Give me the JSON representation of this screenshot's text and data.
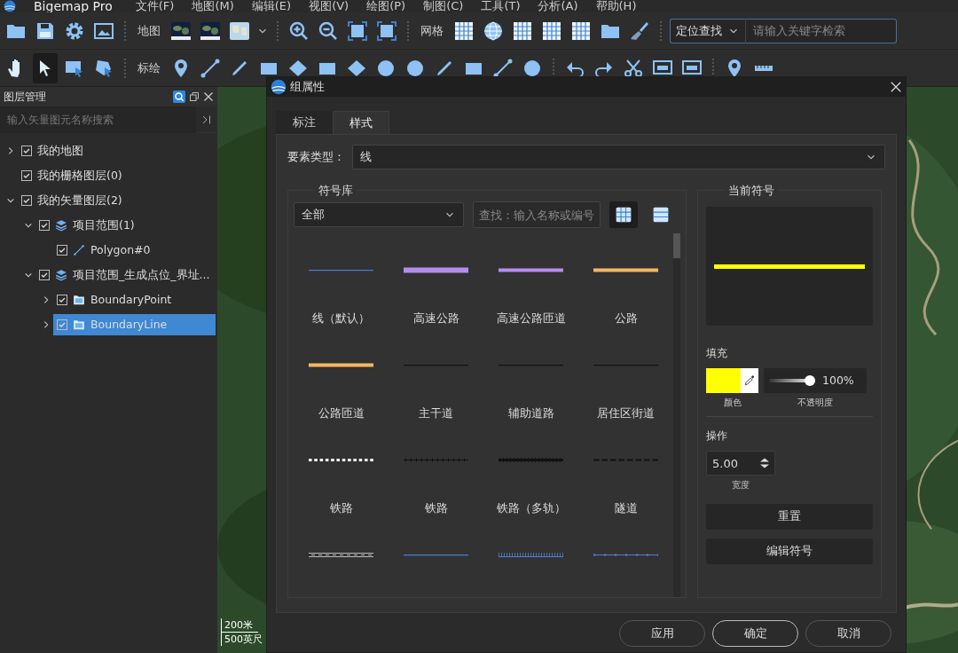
{
  "menu_bar": {
    "app_title": "Bigemap Pro",
    "menus": [
      "文件(F)",
      "地图(M)",
      "编辑(E)",
      "视图(V)",
      "绘图(P)",
      "制图(C)",
      "工具(T)",
      "分析(A)",
      "帮助(H)"
    ]
  },
  "toolbar_1": {
    "map_label": "地图",
    "grid_label": "网格",
    "locate": {
      "mode": "定位查找",
      "placeholder": "请输入关键字检索"
    }
  },
  "toolbar_2": {
    "draw_label": "标绘",
    "tools": [
      {
        "kind": "hand",
        "selected": false
      },
      {
        "kind": "pointer",
        "selected": true
      },
      {
        "kind": "select-box",
        "selected": false
      },
      {
        "kind": "select-shape",
        "selected": false
      }
    ]
  },
  "layer_panel": {
    "title": "图层管理",
    "search_placeholder": "输入矢量图元名称搜索",
    "tree": [
      {
        "label": "我的地图",
        "expandable": true,
        "expanded": false,
        "checked": true,
        "selected": false
      },
      {
        "label": "我的栅格图层(0)",
        "expandable": false,
        "checked": true,
        "selected": false
      },
      {
        "label": "我的矢量图层(2)",
        "expandable": true,
        "expanded": true,
        "checked": true,
        "selected": false,
        "children": [
          {
            "label": "项目范围(1)",
            "expandable": true,
            "expanded": true,
            "kind": "layer",
            "checked": true,
            "selected": false,
            "children": [
              {
                "label": "Polygon#0",
                "expandable": false,
                "kind": "feature",
                "checked": true,
                "selected": false
              }
            ]
          },
          {
            "label": "项目范围_生成点位_界址...",
            "expandable": true,
            "expanded": true,
            "kind": "layer",
            "checked": true,
            "selected": false,
            "children": [
              {
                "label": "BoundaryPoint",
                "expandable": true,
                "expanded": false,
                "kind": "folder",
                "checked": true,
                "selected": false
              },
              {
                "label": "BoundaryLine",
                "expandable": true,
                "expanded": false,
                "kind": "folder",
                "checked": true,
                "selected": true
              }
            ]
          }
        ]
      }
    ]
  },
  "map": {
    "scale_metric": "200米",
    "scale_imperial": "500英尺"
  },
  "dialog": {
    "title": "组属性",
    "tabs": [
      {
        "label": "标注",
        "selected": false
      },
      {
        "label": "样式",
        "selected": true
      }
    ],
    "feature_type": {
      "label": "要素类型：",
      "value": "线"
    },
    "symbol_library": {
      "title": "符号库",
      "category": "全部",
      "search_placeholder": "查找：输入名称或编号",
      "views": [
        {
          "kind": "grid",
          "selected": true
        },
        {
          "kind": "list",
          "selected": false
        }
      ],
      "symbols": [
        {
          "label": "线（默认）",
          "kind": "thin",
          "color": "#4a7fd6"
        },
        {
          "label": "高速公路",
          "kind": "wide",
          "color": "#b48cf0"
        },
        {
          "label": "高速公路匝道",
          "kind": "medium",
          "color": "#b48cf0"
        },
        {
          "label": "公路",
          "kind": "medium",
          "color": "#f5b860"
        },
        {
          "label": "公路匝道",
          "kind": "medium",
          "color": "#f5b860"
        },
        {
          "label": "主干道",
          "kind": "thin",
          "color": "#111111"
        },
        {
          "label": "辅助道路",
          "kind": "thin",
          "color": "#111111"
        },
        {
          "label": "居住区街道",
          "kind": "thin",
          "color": "#111111"
        },
        {
          "label": "铁路",
          "kind": "dotted",
          "color": "#ffffff"
        },
        {
          "label": "铁路",
          "kind": "ticked",
          "color": "#111111"
        },
        {
          "label": "铁路（多轨）",
          "kind": "rail",
          "color": "#111111"
        },
        {
          "label": "隧道",
          "kind": "dashed",
          "color": "#111111"
        },
        {
          "kind": "double",
          "color": "#bbbbbb"
        },
        {
          "kind": "thin",
          "color": "#4a7fd6"
        },
        {
          "kind": "hatched",
          "color": "#4a7fd6"
        },
        {
          "kind": "beaded",
          "color": "#4a7fd6"
        }
      ]
    },
    "current_symbol": {
      "title": "当前符号",
      "fill_label": "填充",
      "color": "#ffff00",
      "color_caption": "颜色",
      "opacity": {
        "level": 1,
        "reading": "100%",
        "caption": "不透明度"
      },
      "operation_label": "操作",
      "width": {
        "value": "5.00",
        "caption": "宽度"
      },
      "buttons": [
        "重置",
        "编辑符号"
      ]
    },
    "buttons": [
      {
        "label": "应用",
        "selected": false
      },
      {
        "label": "确定",
        "selected": true
      },
      {
        "label": "取消",
        "selected": false
      }
    ]
  }
}
